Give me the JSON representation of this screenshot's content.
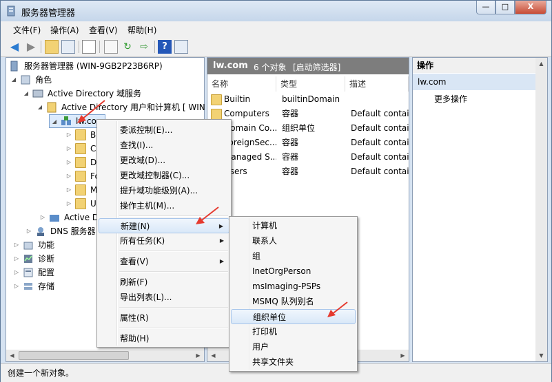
{
  "window": {
    "title": "服务器管理器",
    "min": "—",
    "max": "□",
    "close": "X"
  },
  "menubar": [
    "文件(F)",
    "操作(A)",
    "查看(V)",
    "帮助(H)"
  ],
  "tree": {
    "root": "服务器管理器 (WIN-9GB2P23B6RP)",
    "roles": "角色",
    "adds": "Active Directory 域服务",
    "aduc": "Active Directory 用户和计算机 [ WIN",
    "domain": "lw.com",
    "children": [
      "Bu",
      "Co",
      "D",
      "Fo",
      "M",
      "U"
    ],
    "active_d": "Active D",
    "dns": "DNS 服务器",
    "features": "功能",
    "diagnostics": "诊断",
    "config": "配置",
    "storage": "存储"
  },
  "list": {
    "header_title": "lw.com",
    "header_count": "6 个对象",
    "header_filter": "[启动筛选器]",
    "columns": [
      "名称",
      "类型",
      "描述"
    ],
    "rows": [
      {
        "name": "Builtin",
        "type": "builtinDomain",
        "desc": ""
      },
      {
        "name": "Computers",
        "type": "容器",
        "desc": "Default contain"
      },
      {
        "name": "Domain Co...",
        "type": "组织单位",
        "desc": "Default contain"
      },
      {
        "name": "ForeignSec...",
        "type": "容器",
        "desc": "Default contain"
      },
      {
        "name": "Managed S...",
        "type": "容器",
        "desc": "Default contain"
      },
      {
        "name": "Users",
        "type": "容器",
        "desc": "Default contain"
      }
    ]
  },
  "actions": {
    "title": "操作",
    "section": "lw.com",
    "more": "更多操作"
  },
  "context_menu": {
    "items": [
      "委派控制(E)...",
      "查找(I)...",
      "更改域(D)...",
      "更改域控制器(C)...",
      "提升域功能级别(A)...",
      "操作主机(M)...",
      "新建(N)",
      "所有任务(K)",
      "查看(V)",
      "刷新(F)",
      "导出列表(L)...",
      "属性(R)",
      "帮助(H)"
    ]
  },
  "submenu": {
    "items": [
      "计算机",
      "联系人",
      "组",
      "InetOrgPerson",
      "msImaging-PSPs",
      "MSMQ 队列别名",
      "组织单位",
      "打印机",
      "用户",
      "共享文件夹"
    ]
  },
  "statusbar": "创建一个新对象。",
  "colors": {
    "accent": "#dfe9f5",
    "highlight": "#d9e8f8",
    "arrow": "#e53a2f"
  }
}
